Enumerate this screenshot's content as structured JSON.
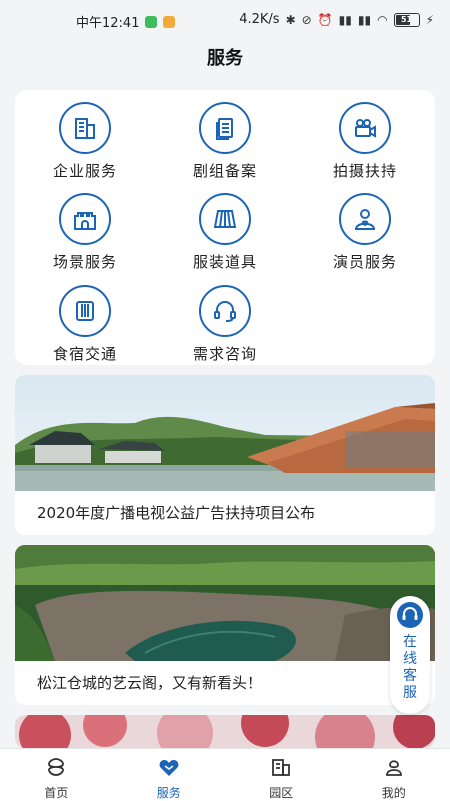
{
  "status_bar": {
    "time": "中午12:41",
    "network_speed": "4.2K/s",
    "battery": "51"
  },
  "page": {
    "title": "服务"
  },
  "services": [
    {
      "label": "企业服务",
      "icon": "building-icon"
    },
    {
      "label": "剧组备案",
      "icon": "document-icon"
    },
    {
      "label": "拍摄扶持",
      "icon": "camera-icon"
    },
    {
      "label": "场景服务",
      "icon": "castle-icon"
    },
    {
      "label": "服装道具",
      "icon": "costume-icon"
    },
    {
      "label": "演员服务",
      "icon": "actor-icon"
    },
    {
      "label": "食宿交通",
      "icon": "bus-icon"
    },
    {
      "label": "需求咨询",
      "icon": "headset-icon"
    }
  ],
  "news": [
    {
      "title": "2020年度广播电视公益广告扶持项目公布"
    },
    {
      "title": "松江仓城的艺云阁，又有新看头！"
    }
  ],
  "customer_service": {
    "text": [
      "在",
      "线",
      "客",
      "服"
    ]
  },
  "nav": {
    "items": [
      {
        "label": "首页",
        "icon": "home-icon"
      },
      {
        "label": "服务",
        "icon": "service-heart-icon",
        "active": true
      },
      {
        "label": "园区",
        "icon": "park-icon"
      },
      {
        "label": "我的",
        "icon": "profile-icon"
      }
    ]
  },
  "colors": {
    "accent": "#1c64b5",
    "background": "#f3f4f6"
  }
}
